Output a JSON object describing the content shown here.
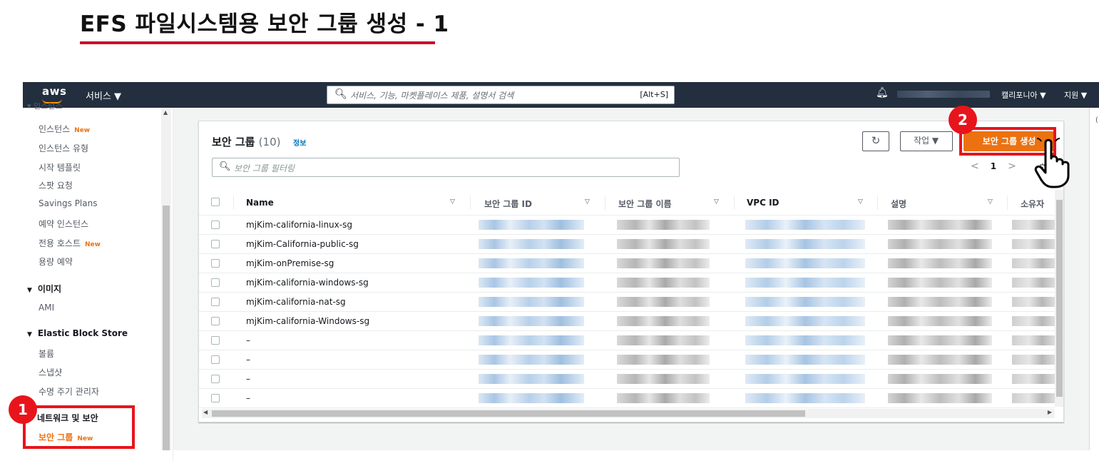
{
  "slide": {
    "title": "EFS 파일시스템용 보안 그룹 생성 - 1",
    "accent_color": "#c8102e"
  },
  "nav": {
    "logo": "aws",
    "services": "서비스 ▼",
    "search_placeholder": "서비스, 기능, 마켓플레이스 제품, 설명서 검색",
    "search_shortcut": "[Alt+S]",
    "region": "캘리포니아 ▼",
    "support": "지원 ▼",
    "icons": [
      "search-icon",
      "bell-icon"
    ]
  },
  "sidebar": {
    "partial_top": "▾ 인스턴스",
    "items": [
      {
        "label": "인스턴스",
        "badge": "New"
      },
      {
        "label": "인스턴스 유형",
        "badge": ""
      },
      {
        "label": "시작 템플릿",
        "badge": ""
      },
      {
        "label": "스팟 요청",
        "badge": ""
      },
      {
        "label": "Savings Plans",
        "badge": ""
      },
      {
        "label": "예약 인스턴스",
        "badge": ""
      },
      {
        "label": "전용 호스트",
        "badge": "New"
      },
      {
        "label": "용량 예약",
        "badge": ""
      }
    ],
    "group_images": "이미지",
    "ami": "AMI",
    "group_ebs": "Elastic Block Store",
    "ebs_items": [
      "볼륨",
      "스냅샷",
      "수명 주기 관리자"
    ],
    "group_network": "네트워크 및 보안",
    "active_item": {
      "label": "보안 그룹",
      "badge": "New"
    }
  },
  "panel": {
    "title": "보안 그룹",
    "count": "(10)",
    "info": "정보",
    "refresh_icon": "refresh-icon",
    "actions_label": "작업 ▼",
    "create_label": "보안 그룹 생성",
    "filter_placeholder": "보안 그룹 필터링",
    "page": "1"
  },
  "table": {
    "columns": [
      "Name",
      "보안 그룹 ID",
      "보안 그룹 이름",
      "VPC ID",
      "설명",
      "소유자"
    ],
    "rows": [
      "mjKim-california-linux-sg",
      "mjKim-California-public-sg",
      "mjKim-onPremise-sg",
      "mjKim-california-windows-sg",
      "mjKim-california-nat-sg",
      "mjKim-california-Windows-sg",
      "–",
      "–",
      "–",
      "–"
    ]
  },
  "annotations": {
    "step1": "1",
    "step2": "2",
    "highlight_color": "#e8141c"
  },
  "colors": {
    "nav_bg": "#232f3e",
    "primary_button": "#ec7211",
    "link": "#0073bb"
  }
}
